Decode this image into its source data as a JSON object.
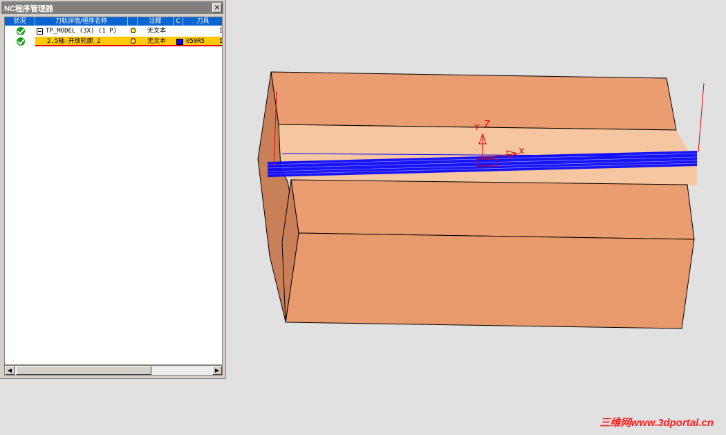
{
  "window": {
    "title": "NC程序管理器",
    "close_label": "×"
  },
  "table": {
    "columns": [
      "状况",
      "刀轨详情/程序名称",
      "",
      "注释",
      "C",
      "刀具"
    ],
    "rows": [
      {
        "name": "TP_MODEL (3X) (1 P)",
        "comment": "无文本",
        "tool": "",
        "trail": "I"
      },
      {
        "name": "2.5轴-开放轮廓_2",
        "comment": "无文本",
        "tool": "050R5",
        "trail": "I"
      }
    ]
  },
  "scrollbar": {
    "left_arrow": "◀",
    "right_arrow": "▶"
  },
  "viewport": {
    "axis_labels": {
      "y": "Y",
      "z": "Z",
      "x": "X"
    },
    "colors": {
      "stock": "#e89a6c",
      "toolpath": "#0000ff",
      "axes": "#e00000"
    }
  },
  "watermark": "三维网www.3dportal.cn"
}
